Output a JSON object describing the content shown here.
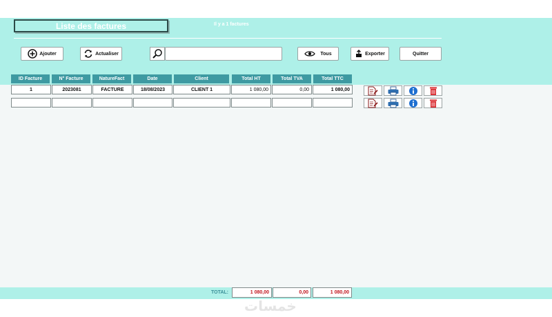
{
  "header": {
    "title": "Liste des factures",
    "count_text": "Il y a 1 factures"
  },
  "toolbar": {
    "add_label": "Ajouter",
    "refresh_label": "Actualiser",
    "search_value": "",
    "all_label": "Tous",
    "export_label": "Exporter",
    "quit_label": "Quitter"
  },
  "table": {
    "columns": [
      "ID Facture",
      "N° Facture",
      "NatureFact",
      "Date",
      "Client",
      "Total HT",
      "Total TVA",
      "Total TTC"
    ],
    "rows": [
      [
        "1",
        "2023081",
        "FACTURE",
        "18/08/2023",
        "CLIENT 1",
        "1 080,00",
        "0,00",
        "1 080,00"
      ],
      [
        "",
        "",
        "",
        "",
        "",
        "",
        "",
        ""
      ]
    ]
  },
  "footer": {
    "total_label": "TOTAL:",
    "total_ht": "1 080,00",
    "total_tva": "0,00",
    "total_ttc": "1 080,00"
  },
  "icons": {
    "edit": "edit-document-icon",
    "print": "printer-icon",
    "info": "info-icon",
    "delete": "trash-icon"
  },
  "colors": {
    "band": "#aef0e8",
    "header_cell": "#3e9aa2",
    "total_red": "#c0121b",
    "delete_red": "#d9252a",
    "info_blue": "#1e6fd0"
  },
  "watermark": "خمسات"
}
